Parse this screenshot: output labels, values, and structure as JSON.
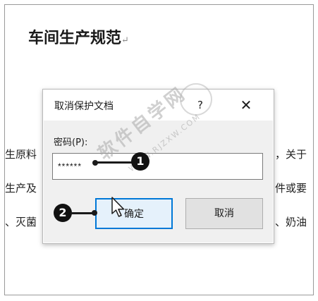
{
  "document": {
    "title": "车间生产规范",
    "paragraph_mark": "↵",
    "lines": [
      {
        "left": "生原料",
        "right": "，关于"
      },
      {
        "left": "生产及",
        "right": "件或要"
      },
      {
        "left": "、灭菌",
        "right": "、奶油"
      }
    ]
  },
  "watermark": {
    "text": "软件自学网",
    "url": "WWW.RJZXW.COM"
  },
  "dialog": {
    "title": "取消保护文档",
    "help_label": "?",
    "close_label": "✕",
    "password_label": "密码(P):",
    "password_value": "******",
    "ok_label": "确定",
    "cancel_label": "取消"
  },
  "callouts": [
    {
      "number": "1"
    },
    {
      "number": "2"
    }
  ],
  "colors": {
    "dialog_body": "#f0f0f0",
    "ok_border": "#0078d7",
    "ok_fill": "#e5f1fb",
    "callout": "#111111"
  },
  "icons": {
    "cursor": "pointer-cursor-icon"
  }
}
